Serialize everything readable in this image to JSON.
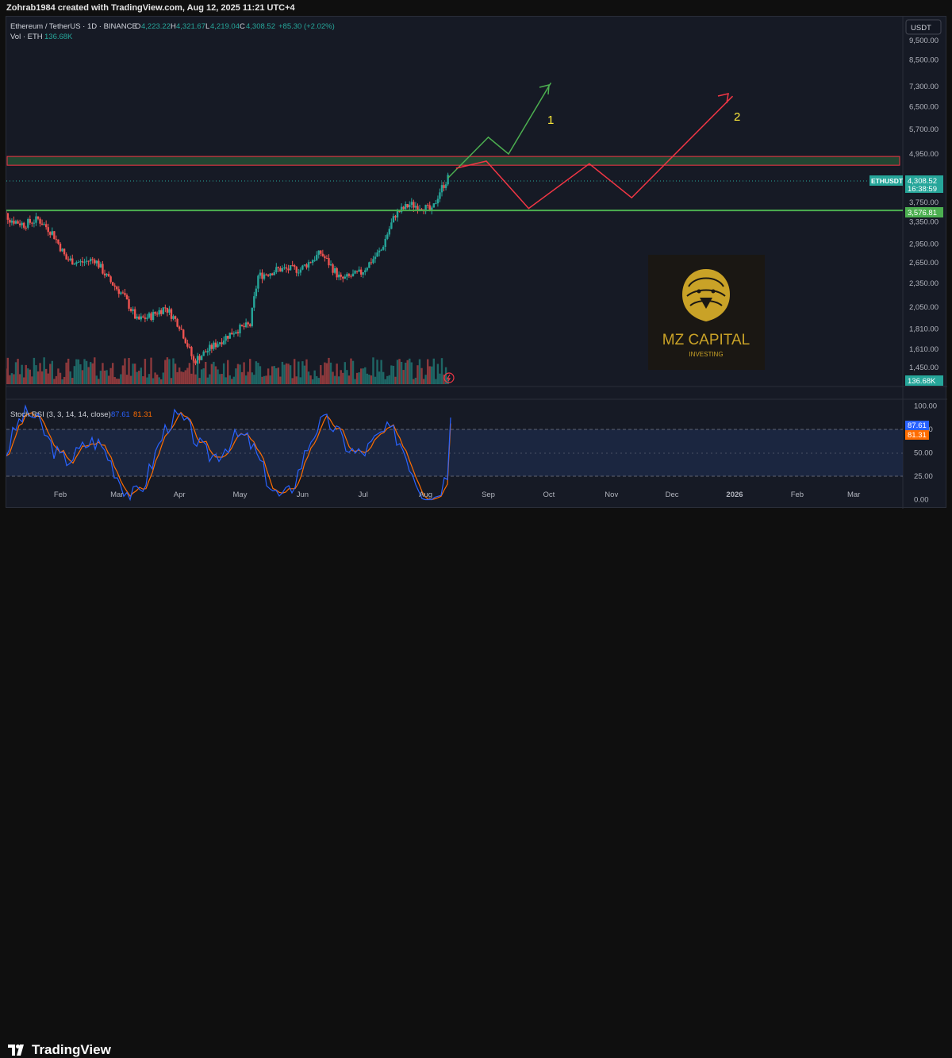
{
  "attribution": "Zohrab1984 created with TradingView.com, Aug 12, 2025 11:21 UTC+4",
  "symbol": {
    "name": "Ethereum / TetherUS · 1D · BINANCE",
    "o_label": "O",
    "o": "4,223.22",
    "h_label": "H",
    "h": "4,321.67",
    "l_label": "L",
    "l": "4,219.04",
    "c_label": "C",
    "c": "4,308.52",
    "change": "+85.30 (+2.02%)",
    "vol_label": "Vol · ETH",
    "vol": "136.68K"
  },
  "currency": "USDT",
  "price_badge": {
    "ticker": "ETHUSDT",
    "price": "4,308.52",
    "countdown": "16:38:59"
  },
  "support_badge": "3,576.81",
  "volume_badge": "136.68K",
  "annotations": {
    "path1": "1",
    "path2": "2"
  },
  "logo": {
    "name": "MZ CAPITAL",
    "sub": "INVESTING",
    "icon": "lion-head-icon"
  },
  "stoch": {
    "label": "Stoch RSI (3, 3, 14, 14, close)",
    "k": "87.61",
    "d": "81.31",
    "k_color": "#2962ff",
    "d_color": "#ff6d00",
    "ticks": [
      "100.00",
      "75.00",
      "50.00",
      "25.00",
      "0.00"
    ]
  },
  "footer": {
    "brand": "TradingView"
  },
  "colors": {
    "up": "#26a69a",
    "down": "#ef5350",
    "support": "#4caf50",
    "zone_border": "#f23645",
    "path1": "#4caf50",
    "path2": "#f23645",
    "annotation_text": "#ffeb3b",
    "background": "#161a25"
  },
  "chart_data": {
    "type": "candlestick",
    "price_axis": {
      "scale": "log",
      "ticks": [
        "9,500.00",
        "8,500.00",
        "7,300.00",
        "6,500.00",
        "5,700.00",
        "4,950.00",
        "3,750.00",
        "3,350.00",
        "2,950.00",
        "2,650.00",
        "2,350.00",
        "2,050.00",
        "1,810.00",
        "1,610.00",
        "1,450.00"
      ]
    },
    "x_axis": {
      "ticks": [
        "Feb",
        "Mar",
        "Apr",
        "May",
        "Jun",
        "Jul",
        "Aug",
        "Sep",
        "Oct",
        "Nov",
        "Dec",
        "2026",
        "Feb",
        "Mar"
      ]
    },
    "support_level": 3576.81,
    "resistance_zone": [
      4640,
      4880
    ],
    "last_price": 4308.52,
    "price_path": [
      [
        "2025-01-01",
        3680
      ],
      [
        "2025-01-07",
        3400
      ],
      [
        "2025-01-14",
        3300
      ],
      [
        "2025-01-21",
        3400
      ],
      [
        "2025-01-28",
        3150
      ],
      [
        "2025-02-04",
        2700
      ],
      [
        "2025-02-11",
        2650
      ],
      [
        "2025-02-18",
        2700
      ],
      [
        "2025-02-25",
        2400
      ],
      [
        "2025-03-04",
        2200
      ],
      [
        "2025-03-11",
        1900
      ],
      [
        "2025-03-18",
        1950
      ],
      [
        "2025-03-25",
        2050
      ],
      [
        "2025-04-01",
        1850
      ],
      [
        "2025-04-08",
        1500
      ],
      [
        "2025-04-15",
        1600
      ],
      [
        "2025-04-22",
        1700
      ],
      [
        "2025-04-29",
        1800
      ],
      [
        "2025-05-06",
        1850
      ],
      [
        "2025-05-10",
        2450
      ],
      [
        "2025-05-20",
        2550
      ],
      [
        "2025-05-31",
        2550
      ],
      [
        "2025-06-10",
        2800
      ],
      [
        "2025-06-20",
        2400
      ],
      [
        "2025-06-30",
        2500
      ],
      [
        "2025-07-10",
        2850
      ],
      [
        "2025-07-17",
        3500
      ],
      [
        "2025-07-24",
        3700
      ],
      [
        "2025-07-31",
        3650
      ],
      [
        "2025-08-04",
        3550
      ],
      [
        "2025-08-08",
        4000
      ],
      [
        "2025-08-12",
        4308.52
      ]
    ],
    "projection_1": [
      [
        "2025-08-12",
        4308.52
      ],
      [
        "2025-09-01",
        5450
      ],
      [
        "2025-09-11",
        4950
      ],
      [
        "2025-10-02",
        7450
      ]
    ],
    "projection_2": [
      [
        "2025-08-16",
        4560
      ],
      [
        "2025-08-31",
        4750
      ],
      [
        "2025-09-21",
        3620
      ],
      [
        "2025-10-21",
        4680
      ],
      [
        "2025-11-11",
        3850
      ],
      [
        "2025-12-31",
        6900
      ]
    ]
  }
}
